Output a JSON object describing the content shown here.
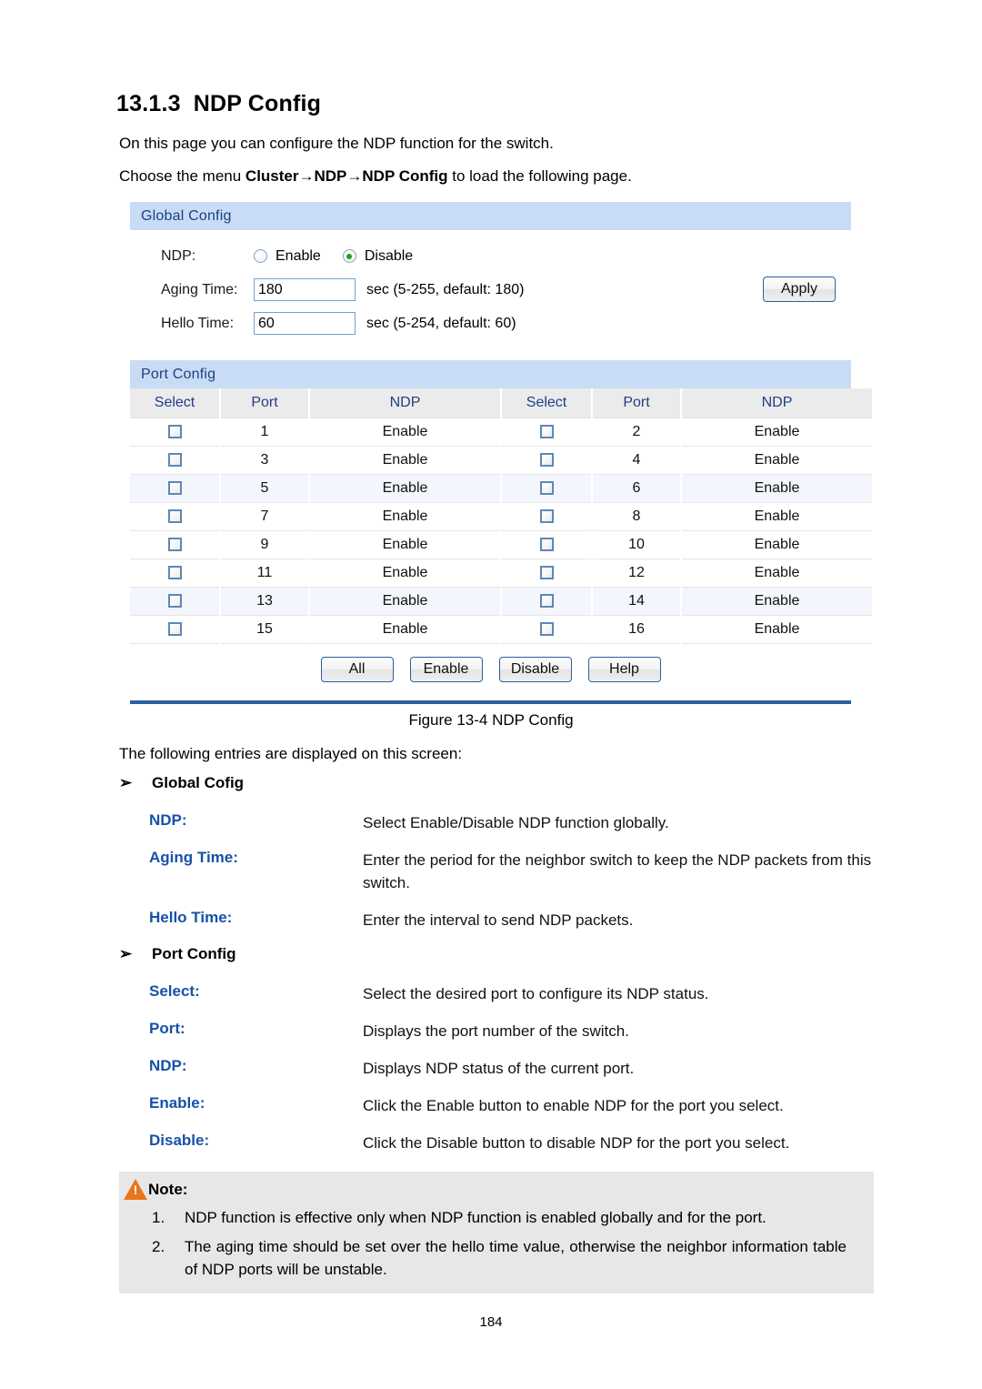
{
  "document": {
    "section_number": "13.1.3",
    "section_title": "NDP Config",
    "intro_line_1": "On this page you can configure the NDP function for the switch.",
    "menu_path_prefix": "Choose the menu ",
    "menu_path_bold_1": "Cluster",
    "menu_arrow_1": "→",
    "menu_path_mid": "NDP",
    "menu_arrow_2": "→",
    "menu_path_bold_2": "NDP Config",
    "menu_path_suffix": " to load the following page.",
    "figure_caption": "Figure 13-4 NDP Config",
    "entries_intro": "The following entries are displayed on this screen:",
    "page_number": "184"
  },
  "screenshot": {
    "global_config": {
      "panel_title": "Global Config",
      "ndp_label": "NDP:",
      "ndp_options": [
        {
          "label": "Enable",
          "selected": false
        },
        {
          "label": "Disable",
          "selected": true
        }
      ],
      "aging_time_label": "Aging Time:",
      "aging_time_value": "180",
      "aging_time_hint": "sec (5-255, default: 180)",
      "hello_time_label": "Hello Time:",
      "hello_time_value": "60",
      "hello_time_hint": "sec (5-254, default: 60)",
      "apply_label": "Apply"
    },
    "port_config": {
      "panel_title": "Port Config",
      "columns": [
        "Select",
        "Port",
        "NDP",
        "Select",
        "Port",
        "NDP"
      ],
      "rows": [
        {
          "left_port": "1",
          "left_ndp": "Enable",
          "left_checked": false,
          "right_port": "2",
          "right_ndp": "Enable",
          "right_checked": false
        },
        {
          "left_port": "3",
          "left_ndp": "Enable",
          "left_checked": false,
          "right_port": "4",
          "right_ndp": "Enable",
          "right_checked": false
        },
        {
          "left_port": "5",
          "left_ndp": "Enable",
          "left_checked": false,
          "right_port": "6",
          "right_ndp": "Enable",
          "right_checked": false
        },
        {
          "left_port": "7",
          "left_ndp": "Enable",
          "left_checked": false,
          "right_port": "8",
          "right_ndp": "Enable",
          "right_checked": false
        },
        {
          "left_port": "9",
          "left_ndp": "Enable",
          "left_checked": false,
          "right_port": "10",
          "right_ndp": "Enable",
          "right_checked": false
        },
        {
          "left_port": "11",
          "left_ndp": "Enable",
          "left_checked": false,
          "right_port": "12",
          "right_ndp": "Enable",
          "right_checked": false
        },
        {
          "left_port": "13",
          "left_ndp": "Enable",
          "left_checked": false,
          "right_port": "14",
          "right_ndp": "Enable",
          "right_checked": false
        },
        {
          "left_port": "15",
          "left_ndp": "Enable",
          "left_checked": false,
          "right_port": "16",
          "right_ndp": "Enable",
          "right_checked": false
        }
      ],
      "buttons": [
        "All",
        "Enable",
        "Disable",
        "Help"
      ]
    }
  },
  "descriptions": {
    "group_1_title": "Global Cofig",
    "group_1_items": [
      {
        "term": "NDP:",
        "definition": "Select Enable/Disable NDP function globally."
      },
      {
        "term": "Aging Time:",
        "definition": "Enter the period for the neighbor switch to keep the NDP packets from this switch."
      },
      {
        "term": "Hello Time:",
        "definition": "Enter the interval to send NDP packets."
      }
    ],
    "group_2_title": "Port Config",
    "group_2_items": [
      {
        "term": "Select:",
        "definition": "Select the desired port to configure its NDP status."
      },
      {
        "term": "Port:",
        "definition": "Displays the port number of the switch."
      },
      {
        "term": "NDP:",
        "definition": "Displays NDP status of the current port."
      },
      {
        "term": "Enable:",
        "definition": "Click the Enable button to enable NDP for the port you select."
      },
      {
        "term": "Disable:",
        "definition": "Click the Disable button to disable NDP for the port you select."
      }
    ]
  },
  "note": {
    "title": "Note:",
    "items": [
      {
        "num": "1.",
        "text": "NDP function is effective only when NDP function is enabled globally and for the port."
      },
      {
        "num": "2.",
        "text": "The aging time should be set over the hello time value, otherwise the neighbor information table of NDP ports will be unstable."
      }
    ]
  }
}
